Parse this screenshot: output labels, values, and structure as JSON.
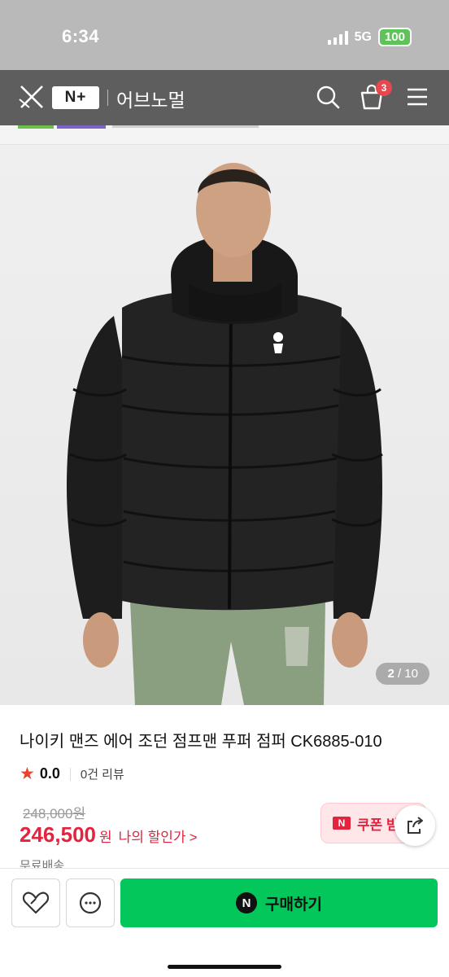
{
  "status_bar": {
    "time": "6:34",
    "network": "5G",
    "battery": "100"
  },
  "header": {
    "badge": "N+",
    "title": "어브노멀",
    "cart_count": "3"
  },
  "image": {
    "current": "2",
    "total": "/ 10"
  },
  "product": {
    "title": "나이키 맨즈 에어 조던 점프맨 푸퍼 점퍼 CK6885-010",
    "rating": "0.0",
    "reviews": "0건 리뷰",
    "original_price": "248,000원",
    "sale_price": "246,500",
    "currency": "원",
    "my_discount": "나의 할인가",
    "chevron": ">",
    "delivery": "무료배송"
  },
  "coupon": {
    "badge": "N",
    "label": "쿠폰 받기"
  },
  "bottom": {
    "buy_badge": "N",
    "buy_label": "구매하기"
  },
  "colors": {
    "accent_green": "#03c75a",
    "price_red": "#e5233f",
    "star": "#e5452f"
  },
  "icons": [
    "close-icon",
    "search-icon",
    "cart-icon",
    "menu-icon",
    "share-icon",
    "heart-icon",
    "chat-icon",
    "star-icon"
  ]
}
